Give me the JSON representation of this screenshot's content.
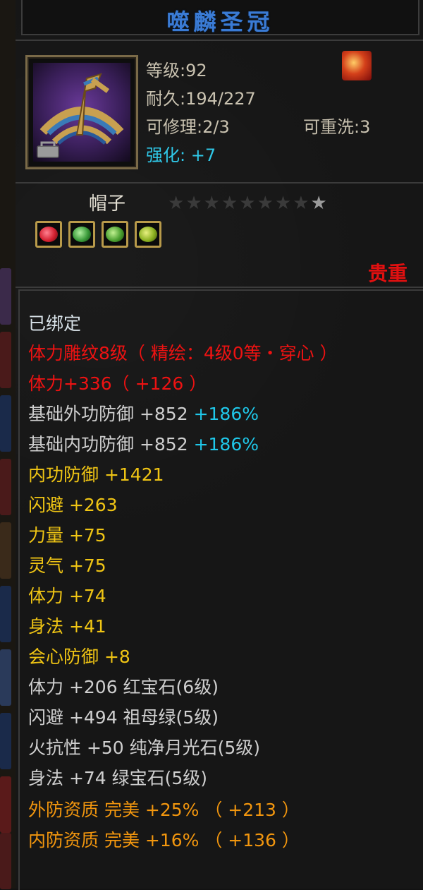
{
  "title": "噬麟圣冠",
  "item": {
    "level": "等级:92",
    "durability": "耐久:194/227",
    "repairable": "可修理:2/3",
    "rewash": "可重洗:3",
    "enhance_label": "强化:",
    "enhance_value": "+7",
    "type": "帽子",
    "stars_total": 9,
    "stars_lit": 1,
    "value_tag": "贵重"
  },
  "gems": [
    {
      "name": "red-gem",
      "color": "#d42030"
    },
    {
      "name": "green-gem",
      "color": "#3a9a3a"
    },
    {
      "name": "green-gem",
      "color": "#4aa030"
    },
    {
      "name": "yellow-green-gem",
      "color": "#8ab020"
    }
  ],
  "attributes": {
    "bound": "已绑定",
    "engrave": "体力雕纹8级（ 精绘：4级0等・穿心 ）",
    "stamina_main": "体力+336（ +126 ）",
    "base_ext_def": "基础外功防御 +852",
    "base_ext_def_pct": "+186%",
    "base_int_def": "基础内功防御 +852",
    "base_int_def_pct": "+186%",
    "int_def": "内功防御 +1421",
    "dodge": "闪避 +263",
    "strength": "力量 +75",
    "spirit": "灵气 +75",
    "stamina": "体力 +74",
    "agility": "身法 +41",
    "crit_def": "会心防御 +8",
    "gem_stamina": "体力 +206 红宝石(6级)",
    "gem_dodge": "闪避 +494 祖母绿(5级)",
    "gem_fire": "火抗性 +50 纯净月光石(5级)",
    "gem_agility": "身法 +74 绿宝石(5级)",
    "ext_quality": "外防资质  完美 +25% （ +213 ）",
    "int_quality": "内防资质  完美 +16% （ +136 ）"
  }
}
